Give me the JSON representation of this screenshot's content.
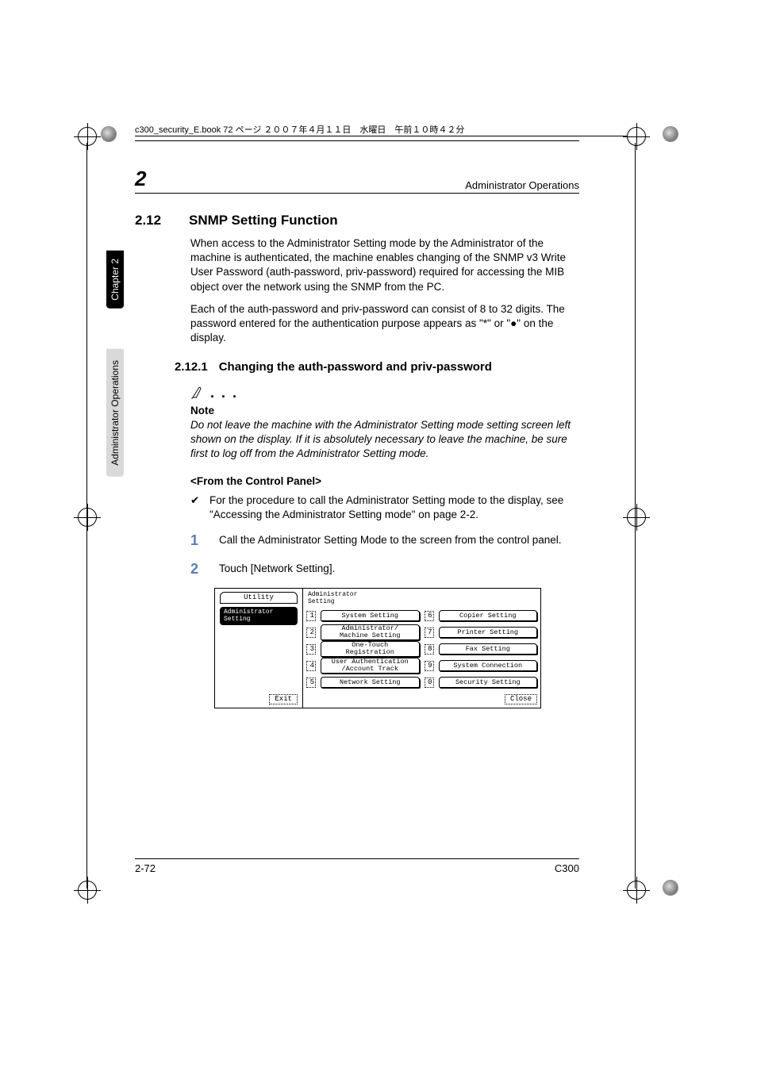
{
  "book_header": "c300_security_E.book  72 ページ  ２００７年４月１１日　水曜日　午前１０時４２分",
  "running_head": {
    "chapter_num": "2",
    "title": "Administrator Operations"
  },
  "side_tabs": {
    "chapter": "Chapter 2",
    "section": "Administrator Operations"
  },
  "section": {
    "num": "2.12",
    "title": "SNMP Setting Function",
    "para1": "When access to the Administrator Setting mode by the Administrator of the machine is authenticated, the machine enables changing of the SNMP v3 Write User Password (auth-password, priv-password) required for accessing the MIB object over the network using the SNMP from the PC.",
    "para2": "Each of the auth-password and priv-password can consist of 8 to 32 digits. The password entered for the authentication purpose appears as \"*\" or \"●\" on the display."
  },
  "subsection": {
    "num": "2.12.1",
    "title": "Changing the auth-password and priv-password"
  },
  "note": {
    "head": "Note",
    "body": "Do not leave the machine with the Administrator Setting mode setting screen left shown on the display. If it is absolutely necessary to leave the machine, be sure first to log off from the Administrator Setting mode."
  },
  "panel_header": "<From the Control Panel>",
  "bullet": {
    "mark": "✔",
    "text": "For the procedure to call the Administrator Setting mode to the display, see \"Accessing the Administrator Setting mode\" on page 2-2."
  },
  "steps": [
    {
      "n": "1",
      "text": "Call the Administrator Setting Mode to the screen from the control panel."
    },
    {
      "n": "2",
      "text": "Touch [Network Setting]."
    }
  ],
  "screenshot": {
    "tab_utility": "Utility",
    "tab_admin": "Administrator\nSetting",
    "panel_title": "Administrator\nSetting",
    "exit": "Exit",
    "close": "Close",
    "items": [
      {
        "n": "1",
        "label": "System Setting"
      },
      {
        "n": "2",
        "label": "Administrator/\nMachine Setting"
      },
      {
        "n": "3",
        "label": "One-Touch\nRegistration"
      },
      {
        "n": "4",
        "label": "User Authentication\n/Account Track"
      },
      {
        "n": "5",
        "label": "Network Setting"
      },
      {
        "n": "6",
        "label": "Copier Setting"
      },
      {
        "n": "7",
        "label": "Printer Setting"
      },
      {
        "n": "8",
        "label": "Fax Setting"
      },
      {
        "n": "9",
        "label": "System Connection"
      },
      {
        "n": "0",
        "label": "Security Setting"
      }
    ]
  },
  "footer": {
    "left": "2-72",
    "right": "C300"
  }
}
